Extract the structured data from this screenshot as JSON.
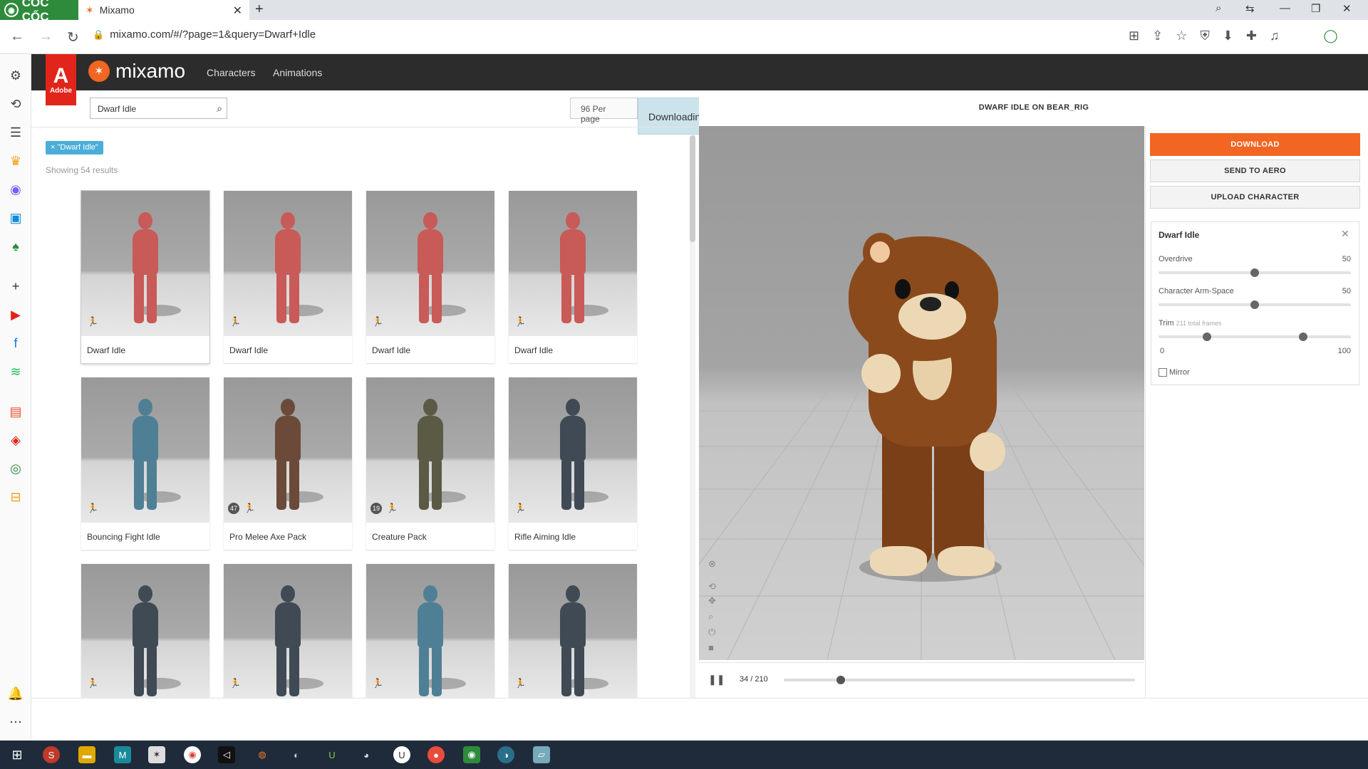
{
  "browser": {
    "logo_text": "CỐC CỐC",
    "tab_title": "Mixamo",
    "url": "mixamo.com/#/?page=1&query=Dwarf+Idle"
  },
  "app": {
    "brand": "mixamo",
    "adobe_label": "Adobe",
    "nav": [
      "Characters",
      "Animations"
    ]
  },
  "search": {
    "value": "Dwarf Idle",
    "per_page": "96 Per page",
    "filter_tag": "× \"Dwarf Idle\"",
    "results_count": "Showing 54 results"
  },
  "toast": {
    "text": "Downloading asset"
  },
  "grid": [
    {
      "label": "Dwarf Idle",
      "kind": "anim",
      "figure_color": "#c85a57"
    },
    {
      "label": "Dwarf Idle",
      "kind": "anim",
      "figure_color": "#c85a57"
    },
    {
      "label": "Dwarf Idle",
      "kind": "anim",
      "figure_color": "#c85a57"
    },
    {
      "label": "Dwarf Idle",
      "kind": "anim",
      "figure_color": "#c85a57"
    },
    {
      "label": "Bouncing Fight Idle",
      "kind": "anim",
      "figure_color": "#4f7f95"
    },
    {
      "label": "Pro Melee Axe Pack",
      "kind": "pack",
      "count": "47",
      "figure_color": "#6b4a3a"
    },
    {
      "label": "Creature Pack",
      "kind": "pack",
      "count": "19",
      "figure_color": "#5b5a45"
    },
    {
      "label": "Rifle Aiming Idle",
      "kind": "anim",
      "figure_color": "#3f4a55"
    },
    {
      "label": "",
      "kind": "anim",
      "figure_color": "#3f4a55"
    },
    {
      "label": "",
      "kind": "anim",
      "figure_color": "#3f4a55"
    },
    {
      "label": "",
      "kind": "anim",
      "figure_color": "#4f7f95"
    },
    {
      "label": "",
      "kind": "anim",
      "figure_color": "#3f4a55"
    }
  ],
  "viewer": {
    "title": "DWARF IDLE ON BEAR_RIG",
    "frame_readout": "34 / 210",
    "current_frame": 34,
    "total_frames": 210
  },
  "actions": {
    "download": "DOWNLOAD",
    "send_to_aero": "SEND TO AERO",
    "upload_character": "UPLOAD CHARACTER"
  },
  "settings": {
    "title": "Dwarf Idle",
    "overdrive_label": "Overdrive",
    "overdrive_value": "50",
    "armspace_label": "Character Arm-Space",
    "armspace_value": "50",
    "trim_label": "Trim",
    "trim_sub": "211 total frames",
    "trim_min": "0",
    "trim_max": "100",
    "trim_start_pct": 25,
    "trim_end_pct": 75,
    "mirror_label": "Mirror"
  },
  "colors": {
    "accent": "#f26522",
    "adobe_red": "#e1251b",
    "header": "#2c2c2c",
    "tag": "#4aaed9"
  }
}
